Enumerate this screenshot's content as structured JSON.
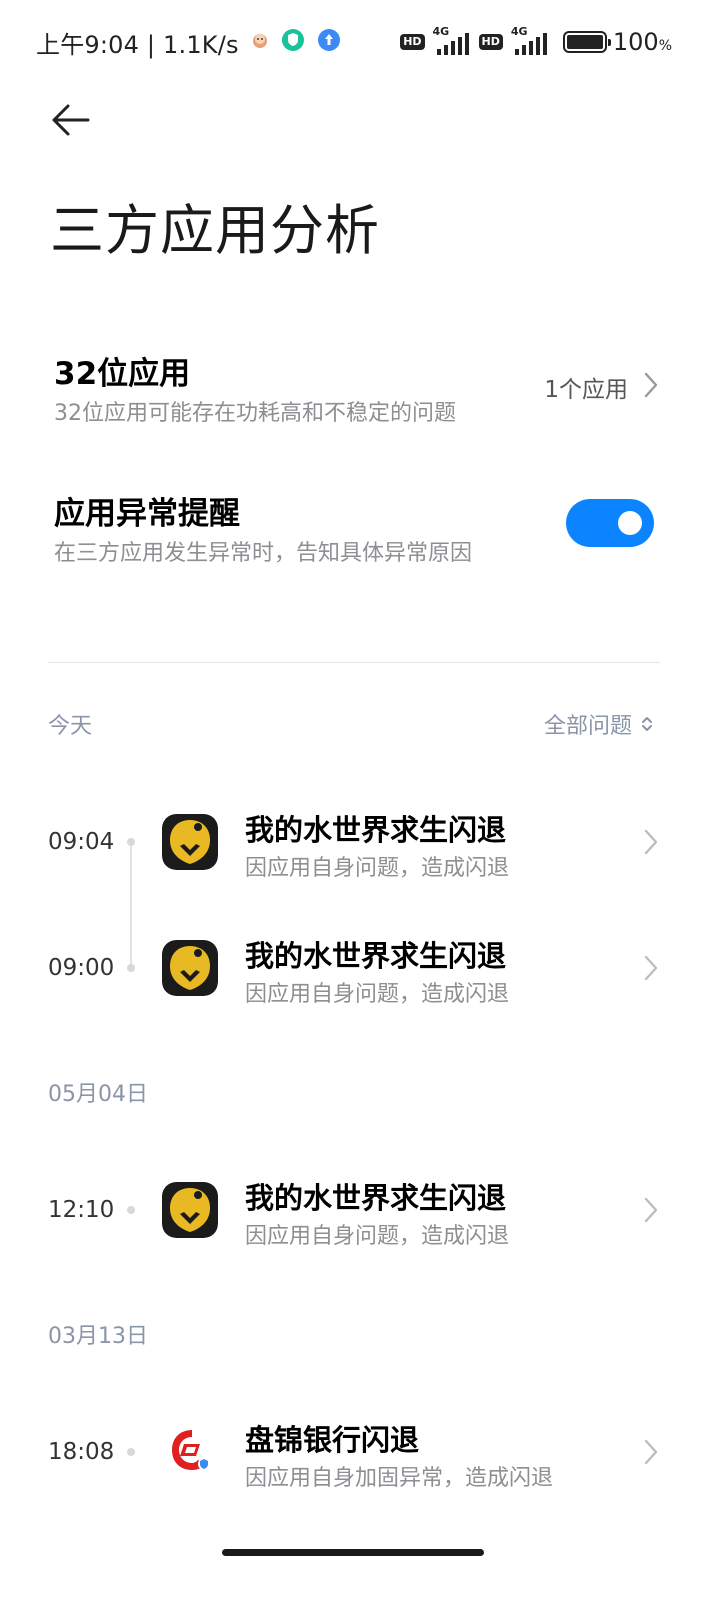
{
  "status_bar": {
    "time": "上午9:04 | 1.1K/s",
    "network_label_1": "4G",
    "network_label_2": "4G",
    "hd_1": "HD",
    "hd_2": "HD",
    "battery_percent": "100",
    "battery_unit": "%",
    "battery_level": 1.0
  },
  "header": {
    "back_icon": "arrow-left-icon",
    "title": "三方应用分析"
  },
  "settings": {
    "bit32": {
      "title": "32位应用",
      "subtitle": "32位应用可能存在功耗高和不稳定的问题",
      "value": "1个应用"
    },
    "alert": {
      "title": "应用异常提醒",
      "subtitle": "在三方应用发生异常时，告知具体异常原因",
      "enabled": true
    }
  },
  "filter": {
    "label": "全部问题",
    "icon": "unfold-chevron-icon"
  },
  "sections": [
    {
      "date": "今天",
      "entries": [
        {
          "time": "09:04",
          "title": "我的水世界求生闪退",
          "subtitle": "因应用自身问题，造成闪退",
          "icon": "game-icon"
        },
        {
          "time": "09:00",
          "title": "我的水世界求生闪退",
          "subtitle": "因应用自身问题，造成闪退",
          "icon": "game-icon"
        }
      ]
    },
    {
      "date": "05月04日",
      "entries": [
        {
          "time": "12:10",
          "title": "我的水世界求生闪退",
          "subtitle": "因应用自身问题，造成闪退",
          "icon": "game-icon"
        }
      ]
    },
    {
      "date": "03月13日",
      "entries": [
        {
          "time": "18:08",
          "title": "盘锦银行闪退",
          "subtitle": "因应用自身加固异常，造成闪退",
          "icon": "bank-icon"
        }
      ]
    }
  ],
  "colors": {
    "accent": "#0d84ff",
    "muted_label": "#8a95a8",
    "game_icon_bg": "#1b1b1b",
    "game_icon_gold": "#e8b923",
    "bank_red": "#e02020"
  }
}
